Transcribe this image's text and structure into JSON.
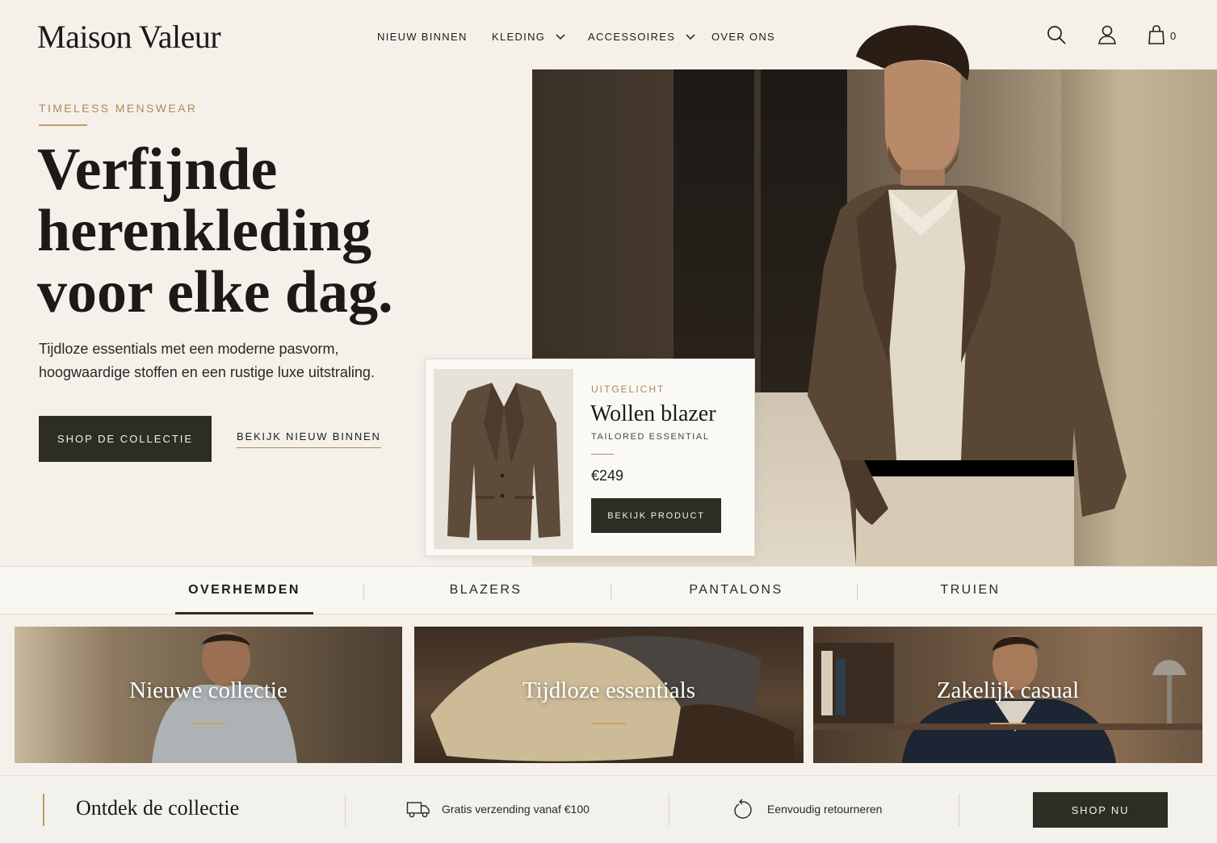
{
  "brand": {
    "name": "Maison Valeur"
  },
  "nav": {
    "items": [
      {
        "label": "NIEUW BINNEN",
        "has_dropdown": false
      },
      {
        "label": "KLEDING",
        "has_dropdown": true
      },
      {
        "label": "ACCESSOIRES",
        "has_dropdown": true
      },
      {
        "label": "OVER ONS",
        "has_dropdown": false
      }
    ]
  },
  "header": {
    "icons": [
      "search-icon",
      "account-icon",
      "bag-icon"
    ],
    "cart_count": "0"
  },
  "hero": {
    "eyebrow": "TIMELESS MENSWEAR",
    "headline_lines": [
      "Verfijnde",
      "herenkleding",
      "voor elke dag."
    ],
    "subcopy_lines": [
      "Tijdloze essentials met een moderne pasvorm,",
      "hoogwaardige stoffen en een rustige luxe uitstraling."
    ],
    "primary_cta": "SHOP DE COLLECTIE",
    "secondary_cta": "BEKIJK NIEUW BINNEN"
  },
  "featured": {
    "label": "UITGELICHT",
    "title": "Wollen blazer",
    "subtitle": "TAILORED ESSENTIAL",
    "price": "€249",
    "cta": "BEKIJK PRODUCT"
  },
  "categories": {
    "tabs": [
      "OVERHEMDEN",
      "BLAZERS",
      "PANTALONS",
      "TRUIEN"
    ],
    "active_index": 0
  },
  "collections": [
    {
      "title": "Nieuwe collectie"
    },
    {
      "title": "Tijdloze essentials"
    },
    {
      "title": "Zakelijk casual"
    }
  ],
  "bottom_bar": {
    "title": "Ontdek de collectie",
    "usps": [
      {
        "icon": "truck-icon",
        "text": "Gratis verzending vanaf €100"
      },
      {
        "icon": "return-icon",
        "text": "Eenvoudig retourneren"
      }
    ],
    "cta": "SHOP NU"
  },
  "colors": {
    "background": "#f5f1ea",
    "accent_gold": "#b08a55",
    "button_dark": "#2c2e24",
    "text_dark": "#1b1a17"
  }
}
